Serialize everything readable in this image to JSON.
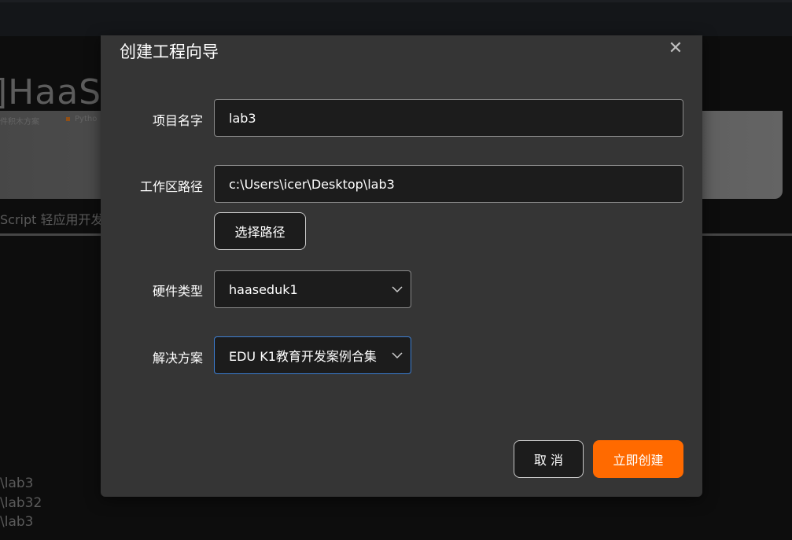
{
  "background": {
    "brand": "]HaaS S",
    "tags": [
      "件积木方案",
      "Pytho"
    ],
    "subtitle": "Script 轻应用开发",
    "recent": [
      "\\lab3",
      "\\lab32",
      "\\lab3"
    ]
  },
  "dialog": {
    "title": "创建工程向导",
    "close_icon": "close-icon",
    "fields": {
      "project_name_label": "项目名字",
      "project_name_value": "lab3",
      "workspace_label": "工作区路径",
      "workspace_value": "c:\\Users\\icer\\Desktop\\lab3",
      "choose_path_button": "选择路径",
      "hardware_label": "硬件类型",
      "hardware_value": "haaseduk1",
      "solution_label": "解决方案",
      "solution_value": "EDU K1教育开发案例合集"
    },
    "buttons": {
      "cancel": "取 消",
      "create": "立即创建"
    }
  },
  "colors": {
    "primary": "#ff6a00",
    "focus_border": "#3d7fd4",
    "dialog_bg": "#353535"
  }
}
